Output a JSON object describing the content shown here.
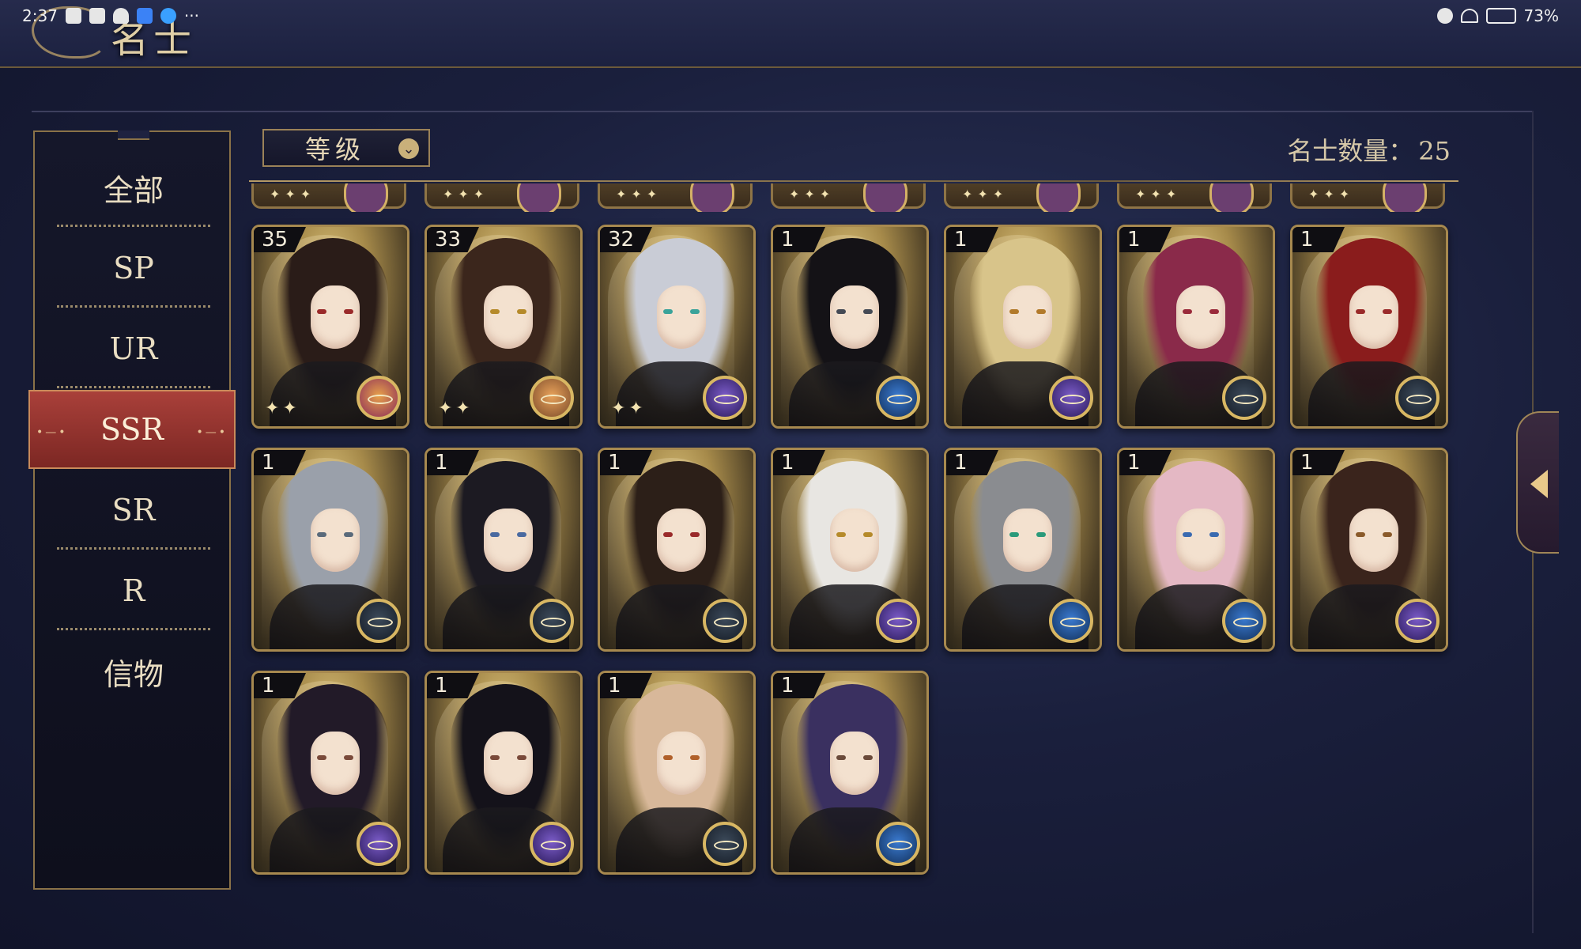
{
  "status_bar": {
    "time": "2:37",
    "dots": "···",
    "battery": "73%"
  },
  "header": {
    "title": "名士"
  },
  "sidebar": {
    "items": [
      {
        "label": "全部",
        "active": false
      },
      {
        "label": "SP",
        "active": false
      },
      {
        "label": "UR",
        "active": false
      },
      {
        "label": "SSR",
        "active": true
      },
      {
        "label": "SR",
        "active": false
      },
      {
        "label": "R",
        "active": false
      },
      {
        "label": "信物",
        "active": false
      }
    ]
  },
  "filter": {
    "selected": "等级",
    "icon": "chevron-down-icon"
  },
  "count": {
    "label": "名士数量：",
    "value": "25"
  },
  "colors": {
    "accent_red": "#a9403a",
    "gold": "#a7894f",
    "bg": "#1a1f3c"
  },
  "cards": [
    {
      "level": "35",
      "emblem": "planet-gold",
      "hair": "#2a1c18",
      "eye": "#9a2a2a"
    },
    {
      "level": "33",
      "emblem": "planet-orange",
      "hair": "#3b261c",
      "eye": "#b58a2a"
    },
    {
      "level": "32",
      "emblem": "planet-purple",
      "hair": "#c9ccd6",
      "eye": "#3aa39a"
    },
    {
      "level": "1",
      "emblem": "planet-blue",
      "hair": "#141216",
      "eye": "#444a55"
    },
    {
      "level": "1",
      "emblem": "planet-purple",
      "hair": "#d8c48a",
      "eye": "#b27a2a"
    },
    {
      "level": "1",
      "emblem": "planet-dark",
      "hair": "#8a2a4a",
      "eye": "#9a2a3a"
    },
    {
      "level": "1",
      "emblem": "planet-dark",
      "hair": "#8a1c1c",
      "eye": "#9a2a2a"
    },
    {
      "level": "1",
      "emblem": "planet-dark",
      "hair": "#9aa0aa",
      "eye": "#5a6a7a"
    },
    {
      "level": "1",
      "emblem": "planet-dark",
      "hair": "#1c1a22",
      "eye": "#4a6aa0"
    },
    {
      "level": "1",
      "emblem": "planet-dark",
      "hair": "#2c1f18",
      "eye": "#9a2a2a"
    },
    {
      "level": "1",
      "emblem": "planet-purple",
      "hair": "#e8e6e2",
      "eye": "#b58a2a"
    },
    {
      "level": "1",
      "emblem": "planet-blue",
      "hair": "#8a8c90",
      "eye": "#2a9a7a"
    },
    {
      "level": "1",
      "emblem": "planet-blue",
      "hair": "#e4b8c4",
      "eye": "#3a6ab0"
    },
    {
      "level": "1",
      "emblem": "planet-purple",
      "hair": "#3a241c",
      "eye": "#8a5a2a"
    },
    {
      "level": "1",
      "emblem": "planet-purple",
      "hair": "#221a28",
      "eye": "#7a4a3a"
    },
    {
      "level": "1",
      "emblem": "planet-purple",
      "hair": "#14121a",
      "eye": "#7a4a3a"
    },
    {
      "level": "1",
      "emblem": "planet-dark",
      "hair": "#d8b89a",
      "eye": "#b0602a"
    },
    {
      "level": "1",
      "emblem": "planet-blue",
      "hair": "#3a3060",
      "eye": "#6a4a3a"
    }
  ],
  "emblem_colors": {
    "planet-gold": [
      "#e7a14a",
      "#8a2a5a"
    ],
    "planet-orange": [
      "#e8a25a",
      "#7a4a2a"
    ],
    "planet-purple": [
      "#7b5cc8",
      "#2a1a5a"
    ],
    "planet-blue": [
      "#3a7ad0",
      "#12305a"
    ],
    "planet-dark": [
      "#3c4a5a",
      "#151c26"
    ]
  }
}
